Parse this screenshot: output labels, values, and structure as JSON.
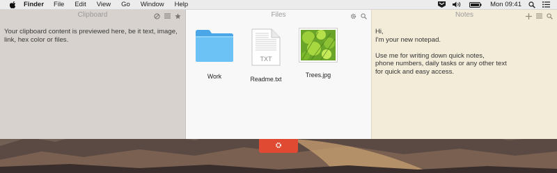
{
  "menubar": {
    "app_name": "Finder",
    "items": [
      "File",
      "Edit",
      "View",
      "Go",
      "Window",
      "Help"
    ],
    "clock": "Mon 09:41",
    "icons": [
      "apple-icon",
      "unclutter-icon",
      "volume-icon",
      "battery-icon",
      "spotlight-icon",
      "list-icon"
    ]
  },
  "clipboard": {
    "title": "Clipboard",
    "text": "Your clipboard content is previewed here, be it text, image, link, hex color or files.",
    "tools": [
      "clear-icon",
      "menu-icon",
      "star-icon"
    ]
  },
  "files": {
    "title": "Files",
    "tools": [
      "gear-icon",
      "search-icon"
    ],
    "items": [
      {
        "name": "Work",
        "icon": "folder-icon"
      },
      {
        "name": "Readme.txt",
        "icon": "text-file-icon",
        "badge": "TXT"
      },
      {
        "name": "Trees.jpg",
        "icon": "image-file-icon"
      }
    ]
  },
  "notes": {
    "title": "Notes",
    "tools": [
      "plus-icon",
      "menu-icon",
      "search-icon"
    ],
    "text": "Hi,\nI'm your new notepad.\n\nUse me for writing down quick notes,\nphone numbers, daily tasks or any other text\nfor quick and easy access."
  },
  "colors": {
    "clipboard_bg": "#d7d2cd",
    "files_bg": "#f8f8f8",
    "notes_bg": "#f3ecd9",
    "gear_button": "#e04a32",
    "folder": "#5bb7f0"
  }
}
